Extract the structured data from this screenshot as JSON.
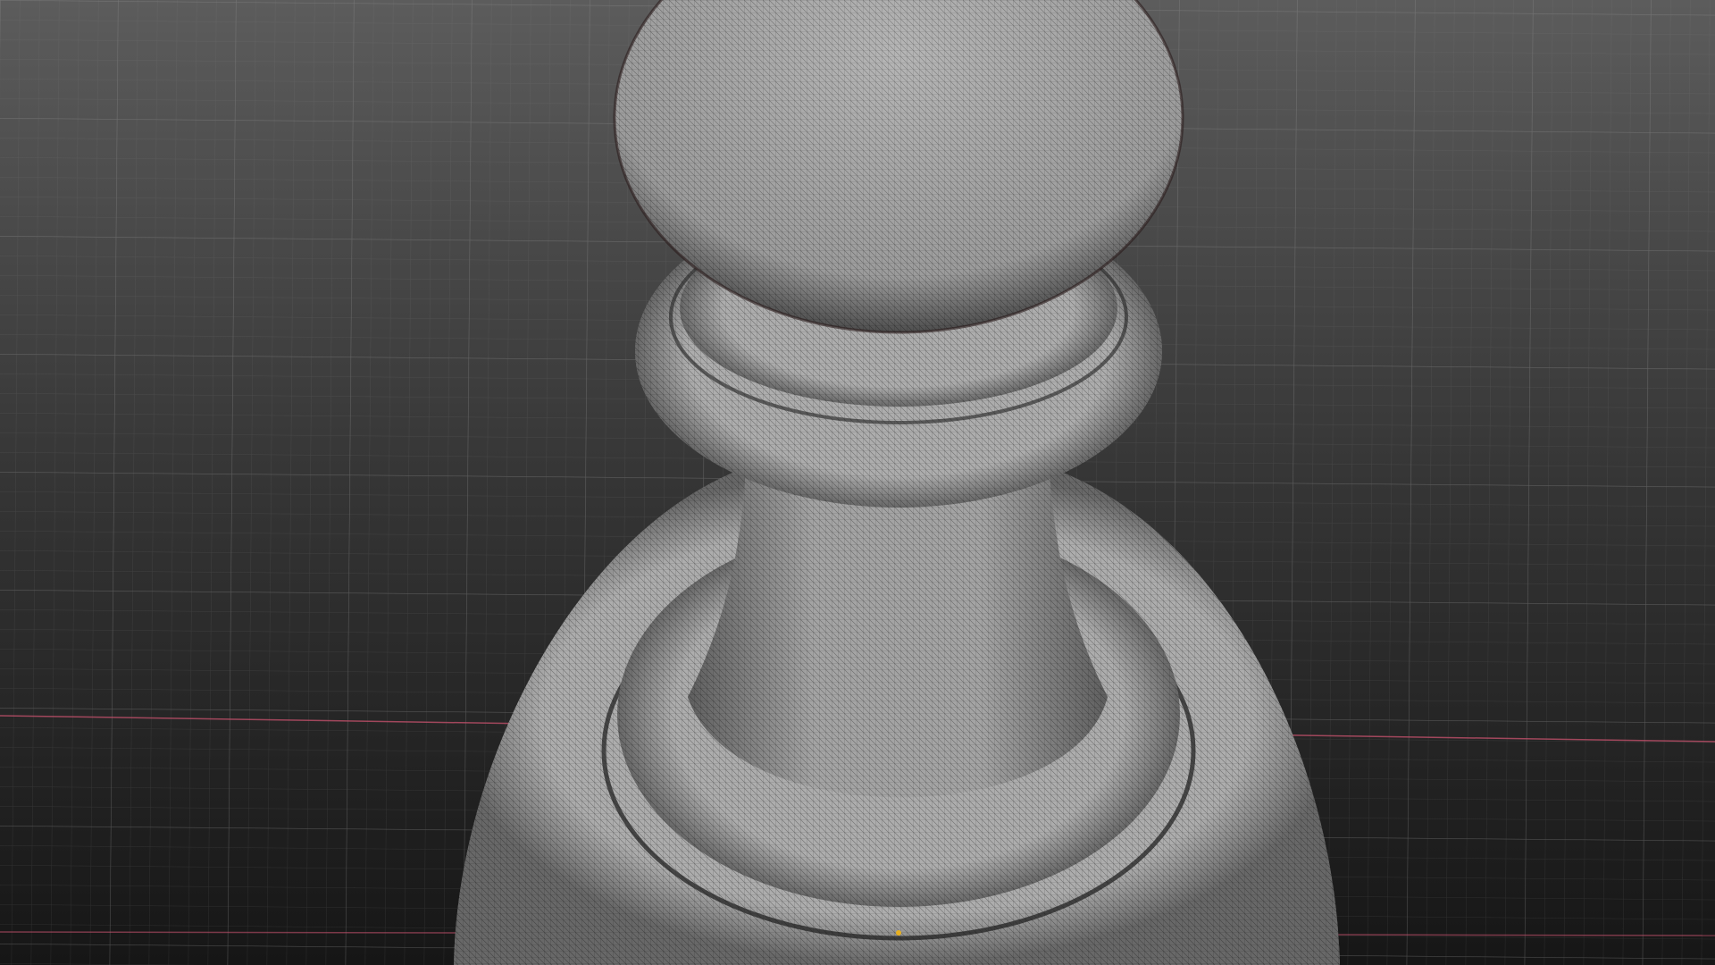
{
  "viewport": {
    "background_top": "#5c5c5c",
    "background_bottom": "#161616",
    "grid_color": "#8a8a8a",
    "x_axis_color": "#c0506a",
    "mesh_fill": "#a9a9a9",
    "mesh_line": "#3a3a3a",
    "selected_vertex_color": "#e8b020"
  }
}
